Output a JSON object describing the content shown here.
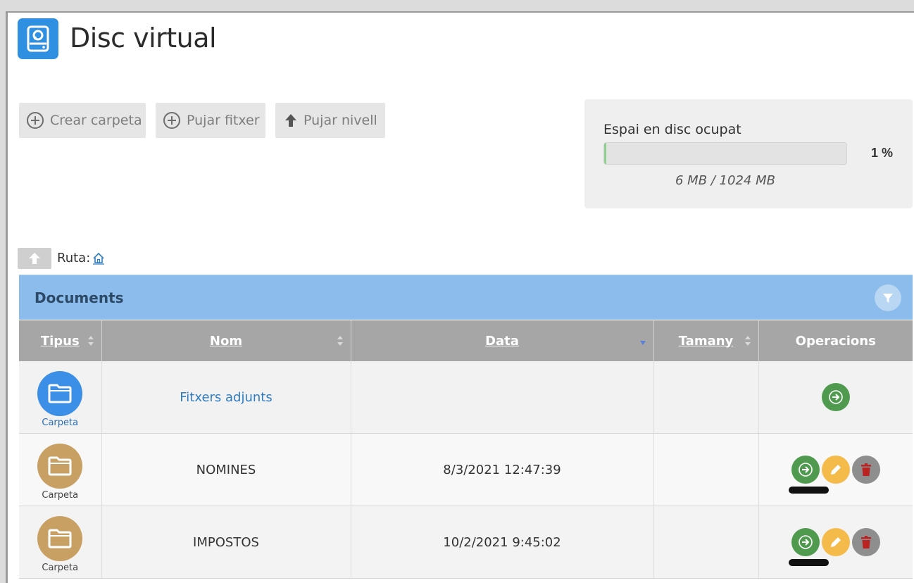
{
  "app": {
    "title": "Disc virtual",
    "icon": "hard-drive-icon",
    "accent": "#2f8fe0"
  },
  "toolbar": {
    "create_folder": "Crear carpeta",
    "upload_file": "Pujar fitxer",
    "go_up": "Pujar nivell"
  },
  "disk": {
    "label": "Espai en disc ocupat",
    "percent_text": "1 %",
    "percent_value": 1,
    "usage_text": "6 MB / 1024 MB",
    "bar_color": "#8fd08f"
  },
  "path": {
    "label": "Ruta:",
    "home_icon": "home-icon"
  },
  "panel": {
    "title": "Documents",
    "header_color": "#8cbcec"
  },
  "table": {
    "headers": {
      "type": "Tipus",
      "name": "Nom",
      "date": "Data",
      "size": "Tamany",
      "operations": "Operacions"
    },
    "sort_column": "Data",
    "rows": [
      {
        "type": "Carpeta",
        "name": "Fitxers adjunts",
        "date": "",
        "size": "",
        "icon_color": "#3b8fe6",
        "ops": [
          "open"
        ]
      },
      {
        "type": "Carpeta",
        "name": "NOMINES",
        "date": "8/3/2021 12:47:39",
        "size": "",
        "icon_color": "#c9a064",
        "ops": [
          "open",
          "edit",
          "delete"
        ]
      },
      {
        "type": "Carpeta",
        "name": "IMPOSTOS",
        "date": "10/2/2021 9:45:02",
        "size": "",
        "icon_color": "#c9a064",
        "ops": [
          "open",
          "edit",
          "delete"
        ]
      }
    ]
  },
  "colors": {
    "op_open": "#4f9a4f",
    "op_edit": "#f5bb4a",
    "op_delete": "#8e8e8e"
  }
}
